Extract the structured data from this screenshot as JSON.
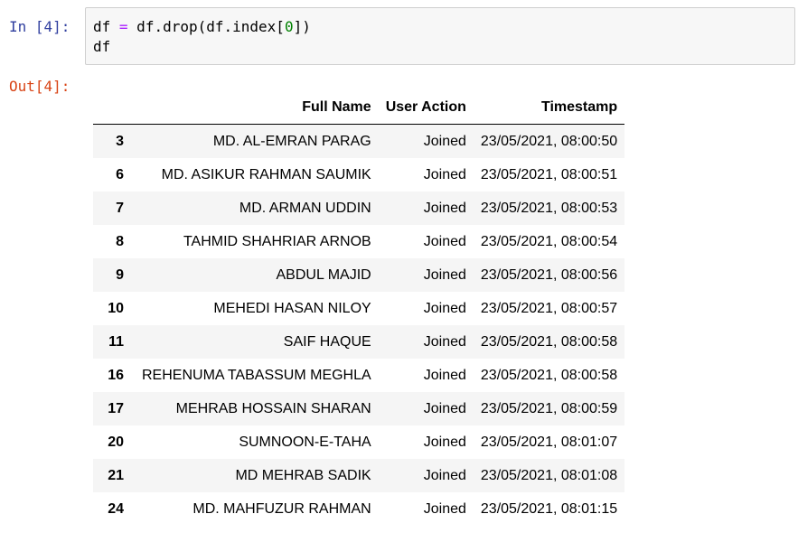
{
  "input_cell": {
    "prompt": "In [4]:",
    "code_line1": {
      "var": "df ",
      "op": "=",
      "call_a": " df.drop(df.index[",
      "num": "0",
      "call_b": "])"
    },
    "code_line2": "df"
  },
  "output_cell": {
    "prompt": "Out[4]:"
  },
  "table": {
    "columns": [
      "Full Name",
      "User Action",
      "Timestamp"
    ],
    "rows": [
      {
        "index": "3",
        "full_name": "MD. AL-EMRAN PARAG",
        "action": "Joined",
        "timestamp": "23/05/2021, 08:00:50"
      },
      {
        "index": "6",
        "full_name": "MD. ASIKUR RAHMAN SAUMIK",
        "action": "Joined",
        "timestamp": "23/05/2021, 08:00:51"
      },
      {
        "index": "7",
        "full_name": "MD. ARMAN UDDIN",
        "action": "Joined",
        "timestamp": "23/05/2021, 08:00:53"
      },
      {
        "index": "8",
        "full_name": "TAHMID SHAHRIAR ARNOB",
        "action": "Joined",
        "timestamp": "23/05/2021, 08:00:54"
      },
      {
        "index": "9",
        "full_name": "ABDUL MAJID",
        "action": "Joined",
        "timestamp": "23/05/2021, 08:00:56"
      },
      {
        "index": "10",
        "full_name": "MEHEDI HASAN NILOY",
        "action": "Joined",
        "timestamp": "23/05/2021, 08:00:57"
      },
      {
        "index": "11",
        "full_name": "SAIF HAQUE",
        "action": "Joined",
        "timestamp": "23/05/2021, 08:00:58"
      },
      {
        "index": "16",
        "full_name": "REHENUMA TABASSUM MEGHLA",
        "action": "Joined",
        "timestamp": "23/05/2021, 08:00:58"
      },
      {
        "index": "17",
        "full_name": "MEHRAB HOSSAIN SHARAN",
        "action": "Joined",
        "timestamp": "23/05/2021, 08:00:59"
      },
      {
        "index": "20",
        "full_name": "SUMNOON-E-TAHA",
        "action": "Joined",
        "timestamp": "23/05/2021, 08:01:07"
      },
      {
        "index": "21",
        "full_name": "MD MEHRAB SADIK",
        "action": "Joined",
        "timestamp": "23/05/2021, 08:01:08"
      },
      {
        "index": "24",
        "full_name": "MD. MAHFUZUR RAHMAN",
        "action": "Joined",
        "timestamp": "23/05/2021, 08:01:15"
      }
    ]
  },
  "colors": {
    "in_prompt": "#303F9F",
    "out_prompt": "#D84315",
    "code_bg": "#f7f7f7",
    "operator": "#AA22FF",
    "number_literal": "#008000",
    "stripe_row": "#f5f5f5"
  }
}
